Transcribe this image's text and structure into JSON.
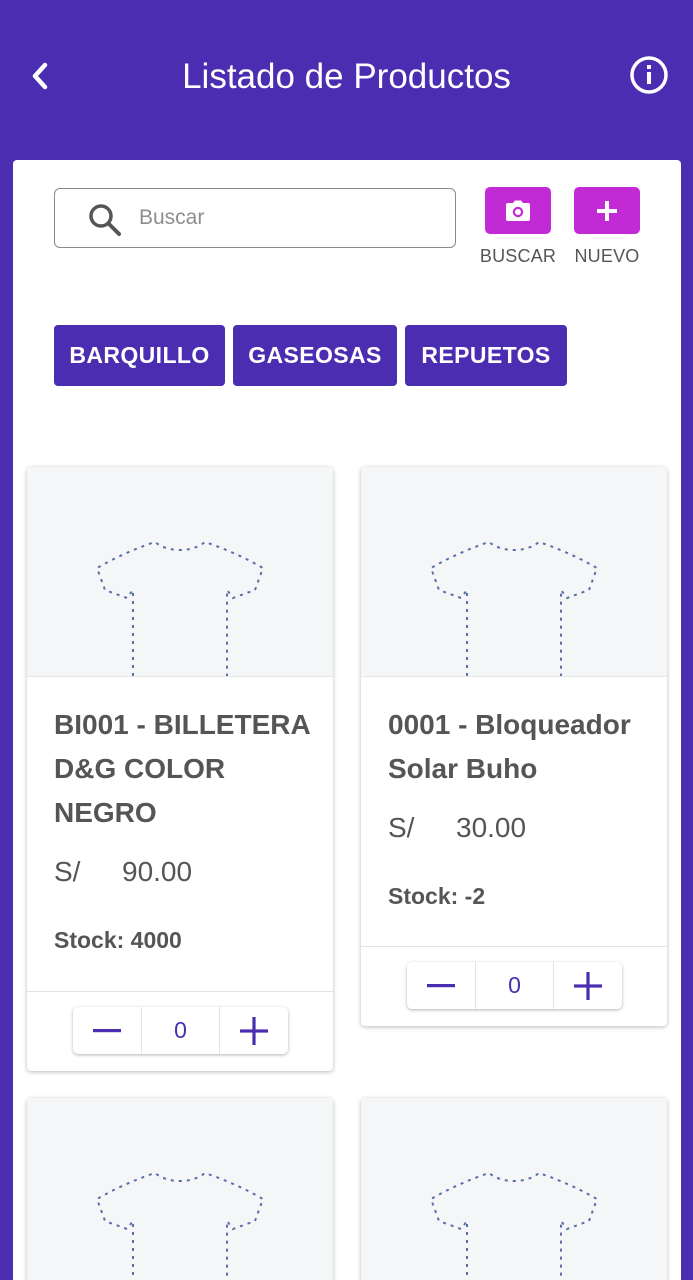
{
  "header": {
    "title": "Listado de Productos",
    "back_icon": "chevron-left-icon",
    "info_icon": "info-icon"
  },
  "colors": {
    "primary": "#4a2db0",
    "accent": "#c22ad6",
    "text": "#555555"
  },
  "search": {
    "placeholder": "Buscar",
    "value": ""
  },
  "actions": {
    "scan": {
      "label": "BUSCAR",
      "icon": "camera-icon"
    },
    "new": {
      "label": "NUEVO",
      "icon": "plus-icon"
    }
  },
  "categories": [
    {
      "label": "BARQUILLO"
    },
    {
      "label": "GASEOSAS"
    },
    {
      "label": "REPUETOS"
    }
  ],
  "products": [
    {
      "title": "BI001 - BILLETERA D&G COLOR NEGRO",
      "currency": "S/",
      "price": "90.00",
      "stock": "Stock: 4000",
      "quantity": "0",
      "image_icon": "tshirt-placeholder-icon"
    },
    {
      "title": "0001 - Bloqueador Solar Buho",
      "currency": "S/",
      "price": "30.00",
      "stock": "Stock: -2",
      "quantity": "0",
      "image_icon": "tshirt-placeholder-icon"
    },
    {
      "image_icon": "tshirt-placeholder-icon"
    },
    {
      "image_icon": "tshirt-placeholder-icon"
    }
  ]
}
